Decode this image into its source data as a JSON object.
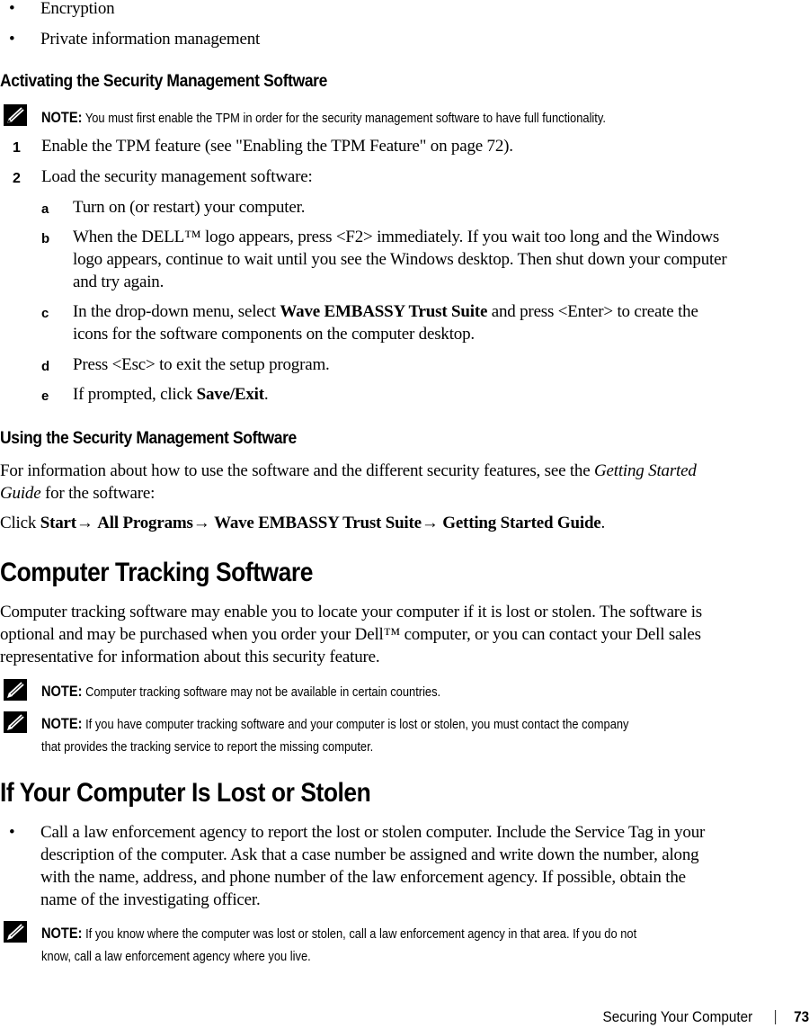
{
  "bullets_top": [
    "Encryption",
    "Private information management"
  ],
  "section_activating": {
    "heading": "Activating the Security Management Software",
    "note_label": "NOTE:",
    "note_text": " You must first enable the TPM in order for the security management software to have full functionality.",
    "steps": [
      {
        "num": "1",
        "text": "Enable the TPM feature (see \"Enabling the TPM Feature\" on page 72)."
      },
      {
        "num": "2",
        "text": "Load the security management software:"
      }
    ],
    "substeps": {
      "a": {
        "letter": "a",
        "text": "Turn on (or restart) your computer."
      },
      "b": {
        "letter": "b",
        "line1": "When the DELL™ logo appears, press <F2> immediately. If you wait too long and the Windows",
        "line2": "logo appears, continue to wait until you see the Windows desktop. Then shut down your computer",
        "line3": "and try again."
      },
      "c": {
        "letter": "c",
        "pre": "In the drop-down menu, select ",
        "bold": "Wave EMBASSY Trust Suite",
        "post": " and press <Enter> to create the",
        "line2": "icons for the software components on the computer desktop."
      },
      "d": {
        "letter": "d",
        "text": "Press <Esc> to exit the setup program."
      },
      "e": {
        "letter": "e",
        "pre": "If prompted, click ",
        "bold": "Save/Exit",
        "post": "."
      }
    }
  },
  "section_using": {
    "heading": "Using the Security Management Software",
    "para_pre": "For information about how to use the software and the different security features, see the ",
    "para_italic1": "Getting Started",
    "para_italic2": "Guide",
    "para_post": " for the software:",
    "click": {
      "prefix": "Click ",
      "items": [
        "Start",
        "All Programs",
        "Wave EMBASSY Trust Suite",
        "Getting Started Guide"
      ],
      "arrow": "→ ",
      "suffix": "."
    }
  },
  "section_tracking": {
    "heading": "Computer Tracking Software",
    "para_lines": [
      "Computer tracking software may enable you to locate your computer if it is lost or stolen. The software is",
      "optional and may be purchased when you order your Dell™ computer, or you can contact your Dell sales",
      "representative for information about this security feature."
    ],
    "notes": [
      {
        "label": "NOTE:",
        "lines": [
          " Computer tracking software may not be available in certain countries."
        ]
      },
      {
        "label": "NOTE:",
        "lines": [
          " If you have computer tracking software and your computer is lost or stolen, you must contact the company",
          "that provides the tracking service to report the missing computer."
        ]
      }
    ]
  },
  "section_lost": {
    "heading": "If Your Computer Is Lost or Stolen",
    "bullet_lines": [
      "Call a law enforcement agency to report the lost or stolen computer. Include the Service Tag in your",
      "description of the computer. Ask that a case number be assigned and write down the number, along",
      "with the name, address, and phone number of the law enforcement agency. If possible, obtain the",
      "name of the investigating officer."
    ],
    "note": {
      "label": "NOTE:",
      "lines": [
        " If you know where the computer was lost or stolen, call a law enforcement agency in that area. If you do not",
        "know, call a law enforcement agency where you live."
      ]
    }
  },
  "footer": {
    "chapter": "Securing Your Computer",
    "page": "73"
  }
}
